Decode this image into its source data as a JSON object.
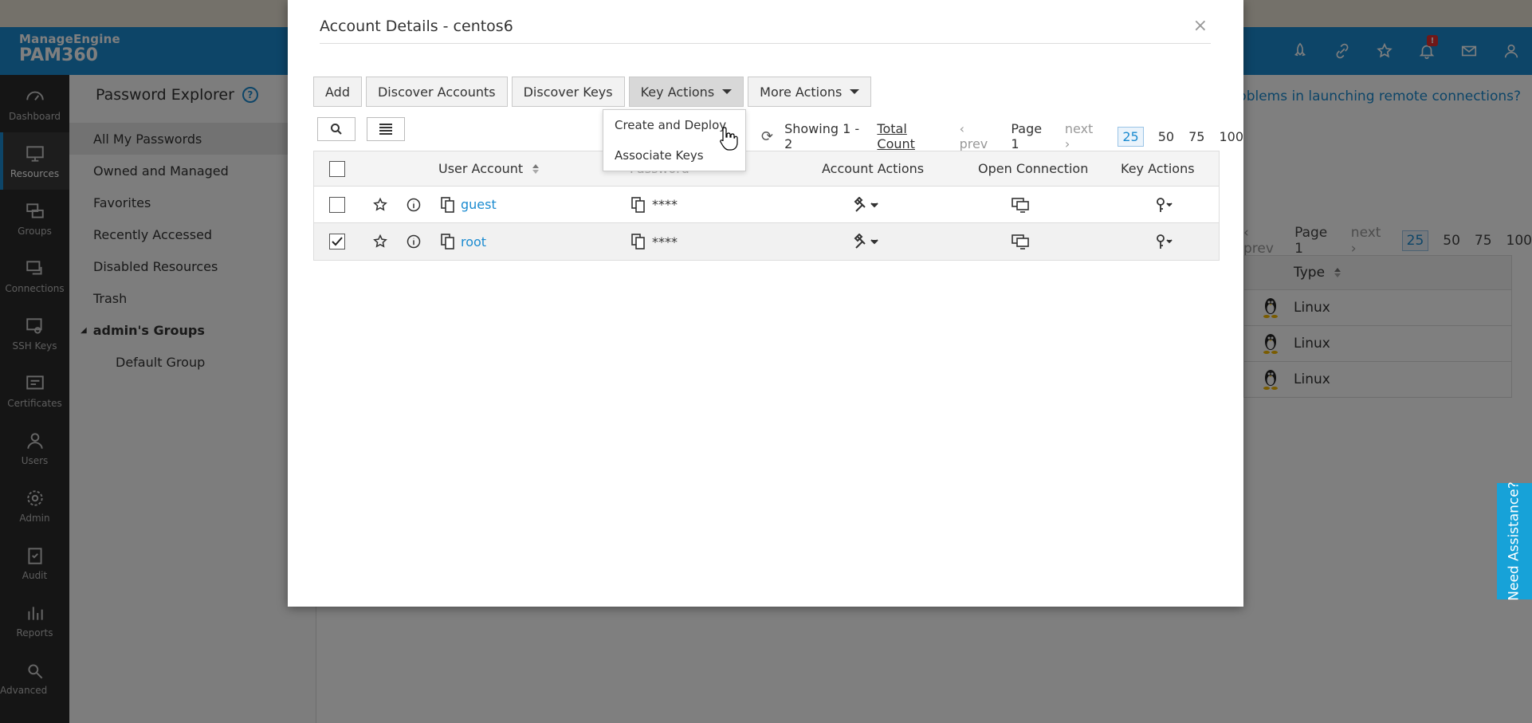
{
  "app": {
    "brand": "ManageEngine",
    "product": "PAM360"
  },
  "header": {
    "icons": [
      "rocket-icon",
      "integration-icon",
      "star-settings-icon",
      "bell-icon",
      "mail-icon",
      "user-icon"
    ],
    "notification_count": "!"
  },
  "leftnav": {
    "items": [
      {
        "label": "Dashboard",
        "icon": "dashboard-icon"
      },
      {
        "label": "Resources",
        "icon": "monitor-icon"
      },
      {
        "label": "Groups",
        "icon": "groups-icon"
      },
      {
        "label": "Connections",
        "icon": "connections-icon"
      },
      {
        "label": "SSH Keys",
        "icon": "ssh-key-icon"
      },
      {
        "label": "Certificates",
        "icon": "certificate-icon"
      },
      {
        "label": "Users",
        "icon": "user-icon"
      },
      {
        "label": "Admin",
        "icon": "gear-icon"
      },
      {
        "label": "Audit",
        "icon": "audit-icon"
      },
      {
        "label": "Reports",
        "icon": "reports-icon"
      },
      {
        "label": "Advanced Analytics",
        "icon": "analytics-icon"
      }
    ]
  },
  "password_explorer": {
    "title": "Password Explorer",
    "help": "?",
    "items": [
      "All My Passwords",
      "Owned and Managed",
      "Favorites",
      "Recently Accessed",
      "Disabled Resources",
      "Trash"
    ],
    "group_title": "admin's Groups",
    "group_items": [
      "Default Group"
    ]
  },
  "background": {
    "warning": "cing problems in launching remote connections?",
    "pager": {
      "prev": "prev",
      "page": "Page 1",
      "next": "next",
      "sizes": [
        "25",
        "50",
        "75",
        "100"
      ]
    },
    "type_header": "Type",
    "types": [
      "Linux",
      "Linux",
      "Linux"
    ]
  },
  "need_assistance": "Need Assistance?",
  "modal": {
    "title": "Account Details - centos6",
    "close": "×",
    "toolbar": {
      "add": "Add",
      "discover_accounts": "Discover Accounts",
      "discover_keys": "Discover Keys",
      "key_actions": "Key Actions",
      "more_actions": "More Actions"
    },
    "dropdown": [
      "Create and Deploy",
      "Associate Keys"
    ],
    "pager": {
      "showing": "Showing 1 - 2",
      "total": "Total Count",
      "prev": "prev",
      "page": "Page 1",
      "next": "next",
      "sizes": [
        "25",
        "50",
        "75",
        "100"
      ]
    },
    "columns": {
      "user_account": "User Account",
      "password": "Password",
      "account_actions": "Account Actions",
      "open_connection": "Open Connection",
      "key_actions": "Key Actions"
    },
    "rows": [
      {
        "account": "guest",
        "password": "****",
        "checked": false
      },
      {
        "account": "root",
        "password": "****",
        "checked": true
      }
    ]
  }
}
